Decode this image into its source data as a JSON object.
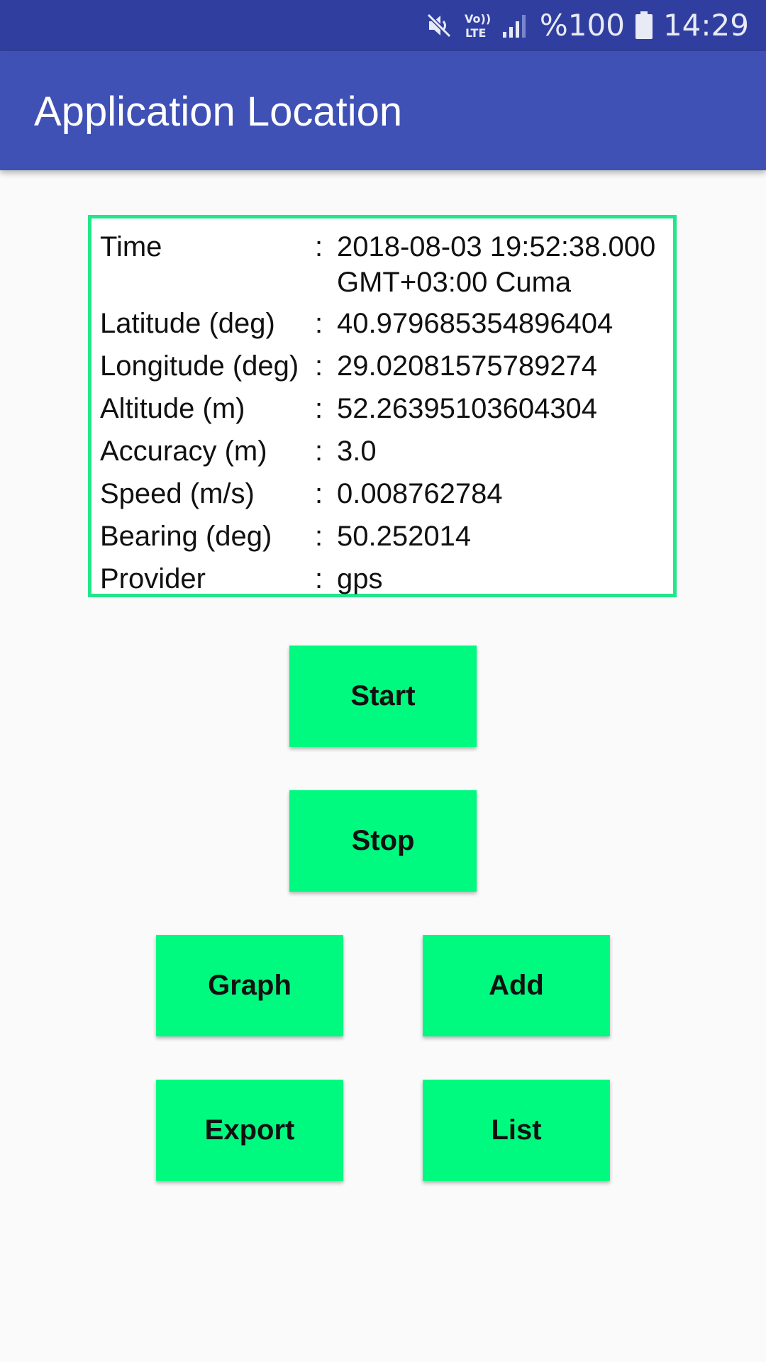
{
  "status_bar": {
    "icons": [
      "mute-icon",
      "volte-lte-icon",
      "signal-icon",
      "battery-icon"
    ],
    "volte_label": "Vo)) LTE",
    "battery_percent": "%100",
    "time": "14:29"
  },
  "app_bar": {
    "title": "Application Location",
    "color": "#3f51b5",
    "status_color": "#303f9f"
  },
  "location_info": {
    "border_color": "#22e68a",
    "rows": [
      {
        "label": "Time",
        "sep": ":",
        "value": "2018-08-03 19:52:38.000 GMT+03:00 Cuma"
      },
      {
        "label": "Latitude (deg)",
        "sep": ":",
        "value": "40.979685354896404"
      },
      {
        "label": "Longitude (deg)",
        "sep": ":",
        "value": "29.02081575789274"
      },
      {
        "label": "Altitude (m)",
        "sep": ":",
        "value": "52.26395103604304"
      },
      {
        "label": "Accuracy (m)",
        "sep": ":",
        "value": "3.0"
      },
      {
        "label": "Speed (m/s)",
        "sep": ":",
        "value": "0.008762784"
      },
      {
        "label": "Bearing (deg)",
        "sep": ":",
        "value": "50.252014"
      },
      {
        "label": "Provider",
        "sep": ":",
        "value": "gps"
      }
    ]
  },
  "buttons": {
    "color": "#00fa80",
    "start": "Start",
    "stop": "Stop",
    "graph": "Graph",
    "add": "Add",
    "export": "Export",
    "list": "List"
  }
}
